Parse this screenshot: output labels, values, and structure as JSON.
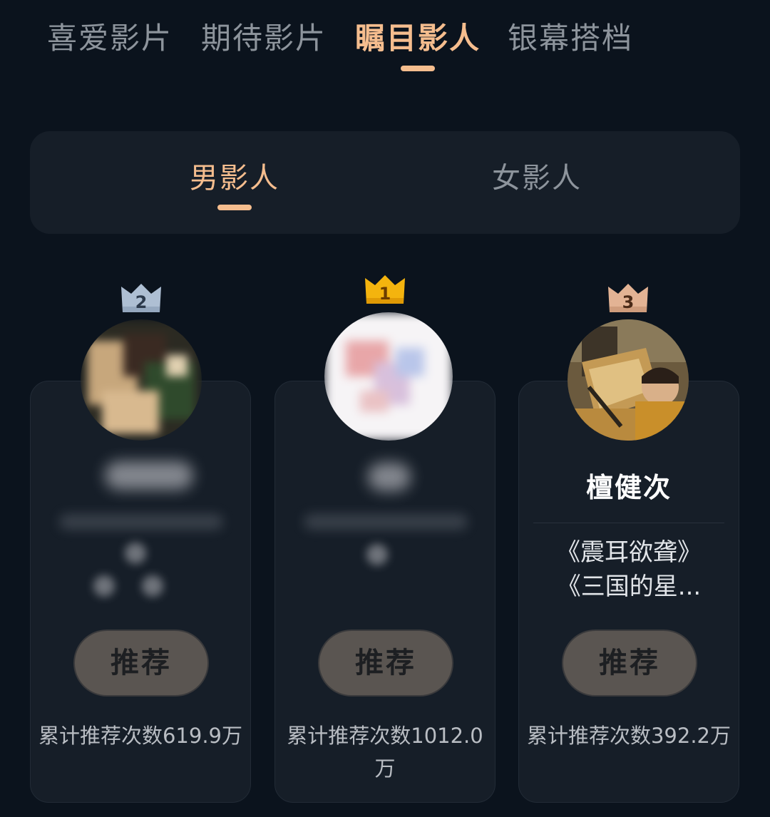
{
  "top_tabs": [
    {
      "label": "喜爱影片",
      "active": false
    },
    {
      "label": "期待影片",
      "active": false
    },
    {
      "label": "瞩目影人",
      "active": true
    },
    {
      "label": "银幕搭档",
      "active": false
    }
  ],
  "gender_tabs": [
    {
      "label": "男影人",
      "active": true
    },
    {
      "label": "女影人",
      "active": false
    }
  ],
  "colors": {
    "accent": "#f5bd8e",
    "background": "#0b131d",
    "card": "#161e28",
    "button": "#5a5551",
    "crown_gold": "#f4b40e",
    "crown_silver": "#aebfd3",
    "crown_bronze": "#e3b394"
  },
  "cards": [
    {
      "rank": "2",
      "crown_icon": "silver-crown-icon",
      "name": "",
      "works": [],
      "button_label": "推荐",
      "count_text": "累计推荐次数619.9万",
      "blurred": true
    },
    {
      "rank": "1",
      "crown_icon": "gold-crown-icon",
      "name": "",
      "works": [],
      "button_label": "推荐",
      "count_text": "累计推荐次数1012.0万",
      "blurred": true
    },
    {
      "rank": "3",
      "crown_icon": "bronze-crown-icon",
      "name": "檀健次",
      "works": [
        "《震耳欲聋》",
        "《三国的星..."
      ],
      "button_label": "推荐",
      "count_text": "累计推荐次数392.2万",
      "blurred": false
    }
  ]
}
